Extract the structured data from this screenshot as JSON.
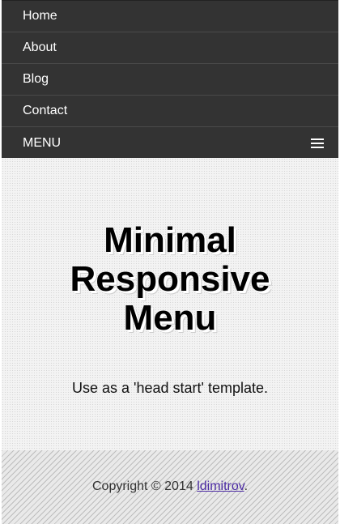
{
  "nav": {
    "items": [
      {
        "label": "Home"
      },
      {
        "label": "About"
      },
      {
        "label": "Blog"
      },
      {
        "label": "Contact"
      }
    ],
    "menu_label": "MENU",
    "menu_icon": "hamburger-icon"
  },
  "main": {
    "title_lines": [
      "Minimal",
      "Responsive",
      "Menu"
    ],
    "subtitle": "Use as a 'head start' template."
  },
  "footer": {
    "copyright": "Copyright © 2014 ",
    "author_link": "ldimitrov",
    "trailing": "."
  },
  "colors": {
    "nav_bg": "#333333",
    "link": "#4b2aa3"
  }
}
